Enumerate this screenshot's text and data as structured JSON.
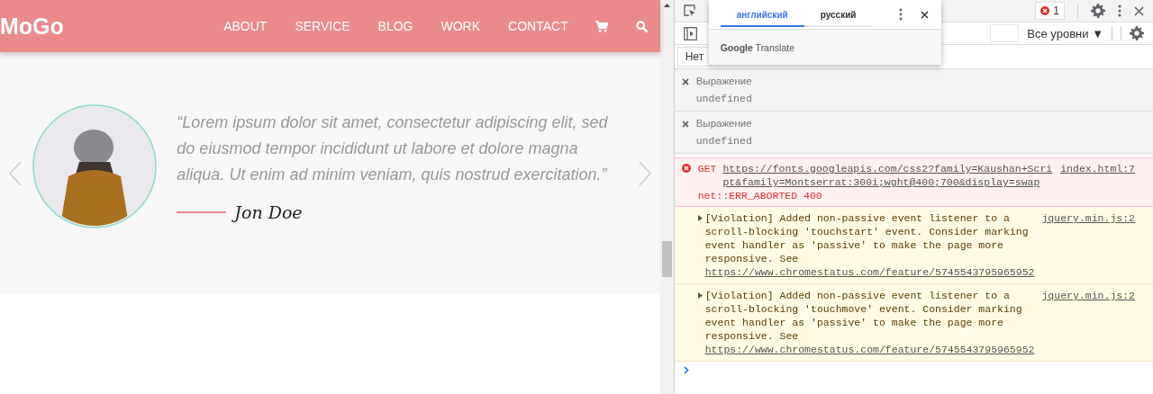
{
  "site": {
    "logo": "MoGo",
    "nav": [
      "ABOUT",
      "SERVICE",
      "BLOG",
      "WORK",
      "CONTACT"
    ],
    "testimonial": {
      "quote": "“Lorem ipsum dolor sit amet, consectetur adipiscing elit, sed do eiusmod tempor incididunt ut labore et dolore magna aliqua. Ut enim ad minim veniam, quis nostrud exercitation.”",
      "author": "Jon Doe"
    }
  },
  "devtools": {
    "error_count": "1",
    "levels_dropdown": "Все уровни ▼",
    "issues_button": "Нет",
    "translate_popup": {
      "tabs": [
        {
          "label": "английский",
          "selected": true
        },
        {
          "label": "русский",
          "selected": false
        }
      ],
      "brand": "**Google** Translate"
    },
    "live_expressions": [
      {
        "label": "Выражение",
        "value": "undefined"
      },
      {
        "label": "Выражение",
        "value": "undefined"
      }
    ],
    "messages": [
      {
        "kind": "error",
        "method": "GET",
        "url": "https://fonts.googleapis.com/css2?family=Kaushan+Script&family=Montserrat:300i;wght@400;700&display=swap",
        "source": "index.html:7",
        "detail": "net::ERR_ABORTED 400"
      },
      {
        "kind": "warning",
        "text": "[Violation] Added non-passive event listener to a scroll-blocking 'touchstart' event. Consider marking event handler as 'passive' to make the page more responsive. See",
        "url": "https://www.chromestatus.com/feature/5745543795965952",
        "source": "jquery.min.js:2"
      },
      {
        "kind": "warning",
        "text": "[Violation] Added non-passive event listener to a scroll-blocking 'touchmove' event. Consider marking event handler as 'passive' to make the page more responsive. See",
        "url": "https://www.chromestatus.com/feature/5745543795965952",
        "source": "jquery.min.js:2"
      }
    ]
  }
}
